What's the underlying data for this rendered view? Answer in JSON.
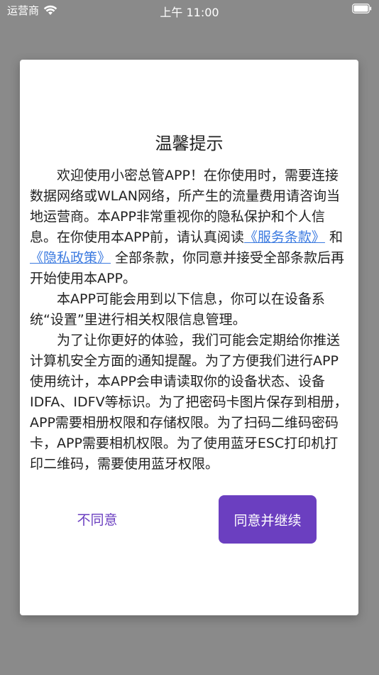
{
  "status_bar": {
    "carrier": "运营商",
    "time": "上午 11:00"
  },
  "dialog": {
    "title": "温馨提示",
    "paragraph1": {
      "part1": "欢迎使用小密总管APP！在你使用时，需要连接数据网络或WLAN网络，所产生的流量费用请咨询当地运营商。本APP非常重视你的隐私保护和个人信息。在你使用本APP前，请认真阅读",
      "terms_link": "《服务条款》",
      "and": " 和",
      "privacy_link": "《隐私政策》",
      "part2": " 全部条款，你同意并接受全部条款后再开始使用本APP。"
    },
    "paragraph2": "本APP可能会用到以下信息，你可以在设备系统“设置”里进行相关权限信息管理。",
    "paragraph3": "为了让你更好的体验，我们可能会定期给你推送计算机安全方面的通知提醒。为了方便我们进行APP使用统计，本APP会申请读取你的设备状态、设备IDFA、IDFV等标识。为了把密码卡图片保存到相册，APP需要相册权限和存储权限。为了扫码二维码密码卡，APP需要相机权限。为了使用蓝牙ESC打印机打印二维码，需要使用蓝牙权限。",
    "disagree_label": "不同意",
    "agree_label": "同意并继续"
  },
  "colors": {
    "accent": "#6b3fc0",
    "link": "#3b7ae0",
    "overlay": "#8a8a8a"
  }
}
